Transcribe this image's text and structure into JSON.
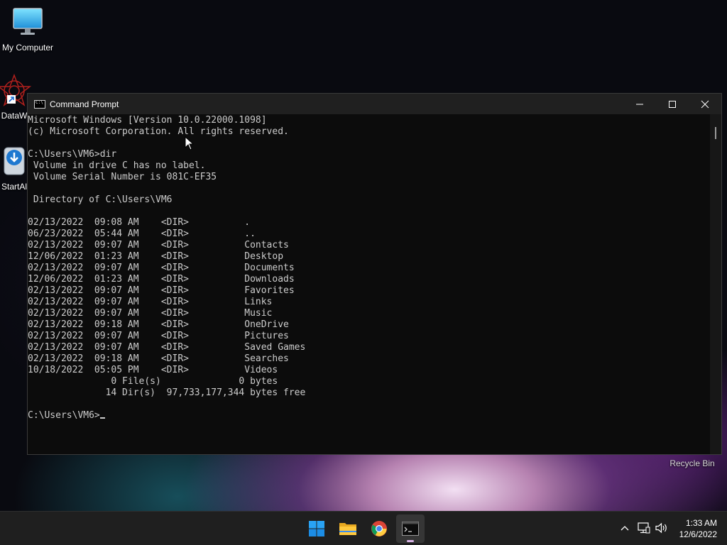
{
  "desktop": {
    "icons": [
      {
        "label": "My Computer",
        "icon": "monitor-icon"
      },
      {
        "label": "DataW",
        "icon": "datawrapper-icon"
      },
      {
        "label": "StartAl",
        "icon": "installer-icon"
      }
    ],
    "recycle_bin": {
      "label": "Recycle Bin",
      "icon": "recycle-bin-icon"
    }
  },
  "window": {
    "title": "Command Prompt",
    "icon": "cmd-icon",
    "controls": {
      "minimize": "minimize-icon",
      "maximize": "maximize-icon",
      "close": "close-icon"
    }
  },
  "console": {
    "lines": [
      "Microsoft Windows [Version 10.0.22000.1098]",
      "(c) Microsoft Corporation. All rights reserved.",
      "",
      "C:\\Users\\VM6>dir",
      " Volume in drive C has no label.",
      " Volume Serial Number is 081C-EF35",
      "",
      " Directory of C:\\Users\\VM6",
      "",
      "02/13/2022  09:08 AM    <DIR>          .",
      "06/23/2022  05:44 AM    <DIR>          ..",
      "02/13/2022  09:07 AM    <DIR>          Contacts",
      "12/06/2022  01:23 AM    <DIR>          Desktop",
      "02/13/2022  09:07 AM    <DIR>          Documents",
      "12/06/2022  01:23 AM    <DIR>          Downloads",
      "02/13/2022  09:07 AM    <DIR>          Favorites",
      "02/13/2022  09:07 AM    <DIR>          Links",
      "02/13/2022  09:07 AM    <DIR>          Music",
      "02/13/2022  09:18 AM    <DIR>          OneDrive",
      "02/13/2022  09:07 AM    <DIR>          Pictures",
      "02/13/2022  09:07 AM    <DIR>          Saved Games",
      "02/13/2022  09:18 AM    <DIR>          Searches",
      "10/18/2022  05:05 PM    <DIR>          Videos",
      "               0 File(s)              0 bytes",
      "              14 Dir(s)  97,733,177,344 bytes free",
      ""
    ],
    "prompt": "C:\\Users\\VM6>"
  },
  "taskbar": {
    "apps": [
      {
        "name": "Start",
        "icon": "windows-start-icon"
      },
      {
        "name": "File Explorer",
        "icon": "folder-icon"
      },
      {
        "name": "Google Chrome",
        "icon": "chrome-icon"
      },
      {
        "name": "Command Prompt",
        "icon": "terminal-icon",
        "active": true
      }
    ],
    "tray": {
      "icons": [
        "chevron-up-icon",
        "network-icon",
        "volume-icon"
      ],
      "time": "1:33 AM",
      "date": "12/6/2022"
    }
  },
  "colors": {
    "console_bg": "#0c0c0c",
    "console_text": "#cccccc",
    "titlebar_bg": "#202020",
    "taskbar_bg": "#1f1f1f",
    "active_indicator": "#d8b3e6"
  }
}
